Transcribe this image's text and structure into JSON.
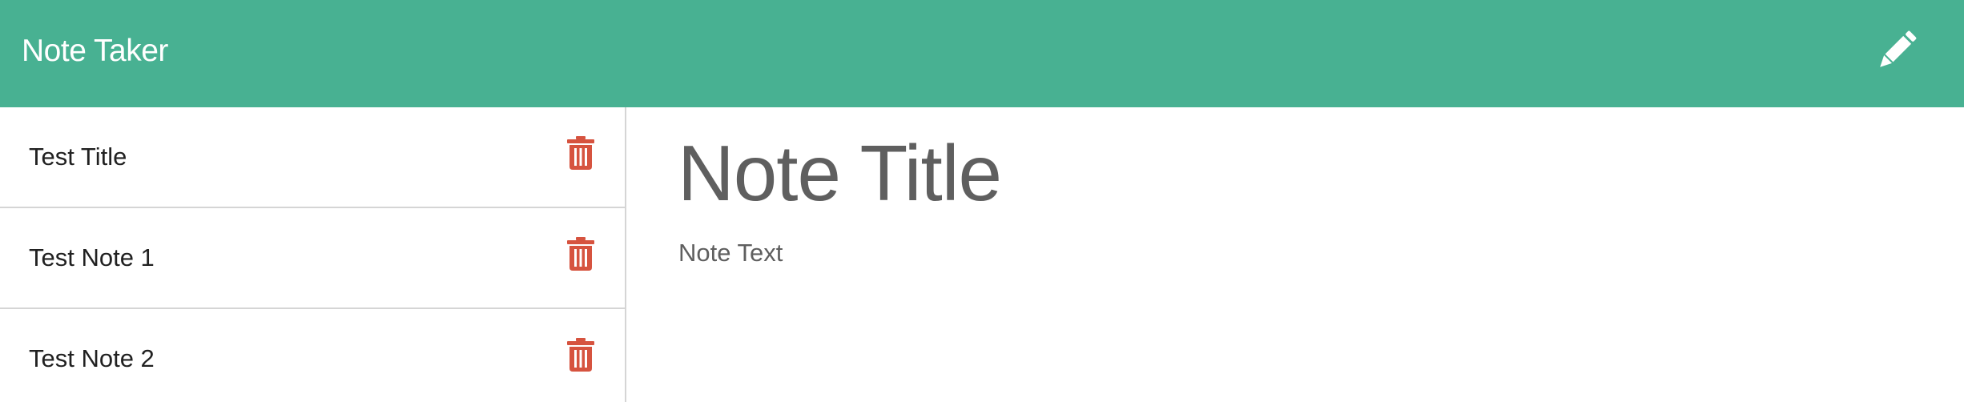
{
  "navbar": {
    "brand": "Note Taker",
    "new_note_icon": "pencil-icon",
    "background": "#48b192"
  },
  "notes": [
    {
      "title": "Test Title",
      "delete_icon": "trash-icon"
    },
    {
      "title": "Test Note 1",
      "delete_icon": "trash-icon"
    },
    {
      "title": "Test Note 2",
      "delete_icon": "trash-icon"
    }
  ],
  "editor": {
    "title_placeholder": "Note Title",
    "text_placeholder": "Note Text"
  },
  "colors": {
    "accent": "#48b192",
    "delete": "#d6533f",
    "text": "#212121",
    "placeholder": "#5f5f5f"
  }
}
